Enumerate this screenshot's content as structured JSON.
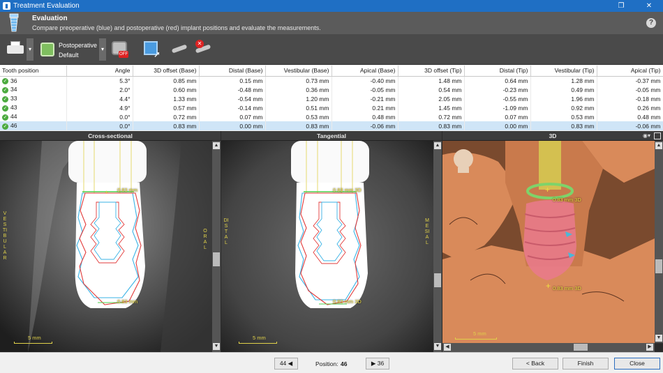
{
  "window": {
    "title": "Treatment Evaluation",
    "controls": [
      "❐",
      "✕"
    ]
  },
  "header": {
    "title": "Evaluation",
    "description": "Compare preoperative (blue) and postoperative (red) implant positions and evaluate the measurements.",
    "help_glyph": "?"
  },
  "toolbar": {
    "mode_label": "Postoperative",
    "mode_value": "Default",
    "off_badge": "OFF",
    "dropdown_glyph": "▾",
    "tools": [
      "printer-icon",
      "tooth-model-icon",
      "camera-off-icon",
      "view-3d-icon",
      "measure-tool-icon",
      "remove-measure-icon"
    ]
  },
  "table": {
    "headers": [
      "Tooth position",
      "Angle",
      "3D offset (Base)",
      "Distal (Base)",
      "Vestibular (Base)",
      "Apical (Base)",
      "3D offset (Tip)",
      "Distal (Tip)",
      "Vestibular (Tip)",
      "Apical (Tip)"
    ],
    "rows": [
      [
        "36",
        "5.3°",
        "0.85 mm",
        "0.15 mm",
        "0.73 mm",
        "-0.40 mm",
        "1.48 mm",
        "0.64 mm",
        "1.28 mm",
        "-0.37 mm"
      ],
      [
        "34",
        "2.0°",
        "0.60 mm",
        "-0.48 mm",
        "0.36 mm",
        "-0.05 mm",
        "0.54 mm",
        "-0.23 mm",
        "0.49 mm",
        "-0.05 mm"
      ],
      [
        "33",
        "4.4°",
        "1.33 mm",
        "-0.54 mm",
        "1.20 mm",
        "-0.21 mm",
        "2.05 mm",
        "-0.55 mm",
        "1.96 mm",
        "-0.18 mm"
      ],
      [
        "43",
        "4.9°",
        "0.57 mm",
        "-0.14 mm",
        "0.51 mm",
        "0.21 mm",
        "1.45 mm",
        "-1.09 mm",
        "0.92 mm",
        "0.26 mm"
      ],
      [
        "44",
        "0.0°",
        "0.72 mm",
        "0.07 mm",
        "0.53 mm",
        "0.48 mm",
        "0.72 mm",
        "0.07 mm",
        "0.53 mm",
        "0.48 mm"
      ],
      [
        "46",
        "0.0°",
        "0.83 mm",
        "0.00 mm",
        "0.83 mm",
        "-0.06 mm",
        "0.83 mm",
        "0.00 mm",
        "0.83 mm",
        "-0.06 mm"
      ]
    ],
    "selected_row": 5
  },
  "views": {
    "cross_sectional": {
      "title": "Cross-sectional",
      "left_label": "VESTIBULAR",
      "right_label": "ORAL",
      "top_measure": "0.83 mm",
      "bottom_measure": "0.83 mm",
      "scale": "5 mm"
    },
    "tangential": {
      "title": "Tangential",
      "left_label": "DISTAL",
      "right_label": "MESIAL",
      "top_measure": "0.83 mm 3D",
      "bottom_measure": "0.83 mm 3D",
      "scale": "5 mm"
    },
    "three_d": {
      "title": "3D",
      "top_measure": "0.83 mm 3D",
      "bottom_measure": "0.83 mm 3D",
      "scale": "5 mm"
    }
  },
  "footer": {
    "prev_label": "44 ◀",
    "position_label": "Position:",
    "position_value": "46",
    "next_label": "▶ 36",
    "back_label": "< Back",
    "finish_label": "Finish",
    "close_label": "Close"
  },
  "colors": {
    "titlebar": "#1f6fc4",
    "preoperative": "#3ab3e6",
    "postoperative": "#e23b3b",
    "measure": "#f0e040",
    "bone_3d": "#d98a5a"
  }
}
